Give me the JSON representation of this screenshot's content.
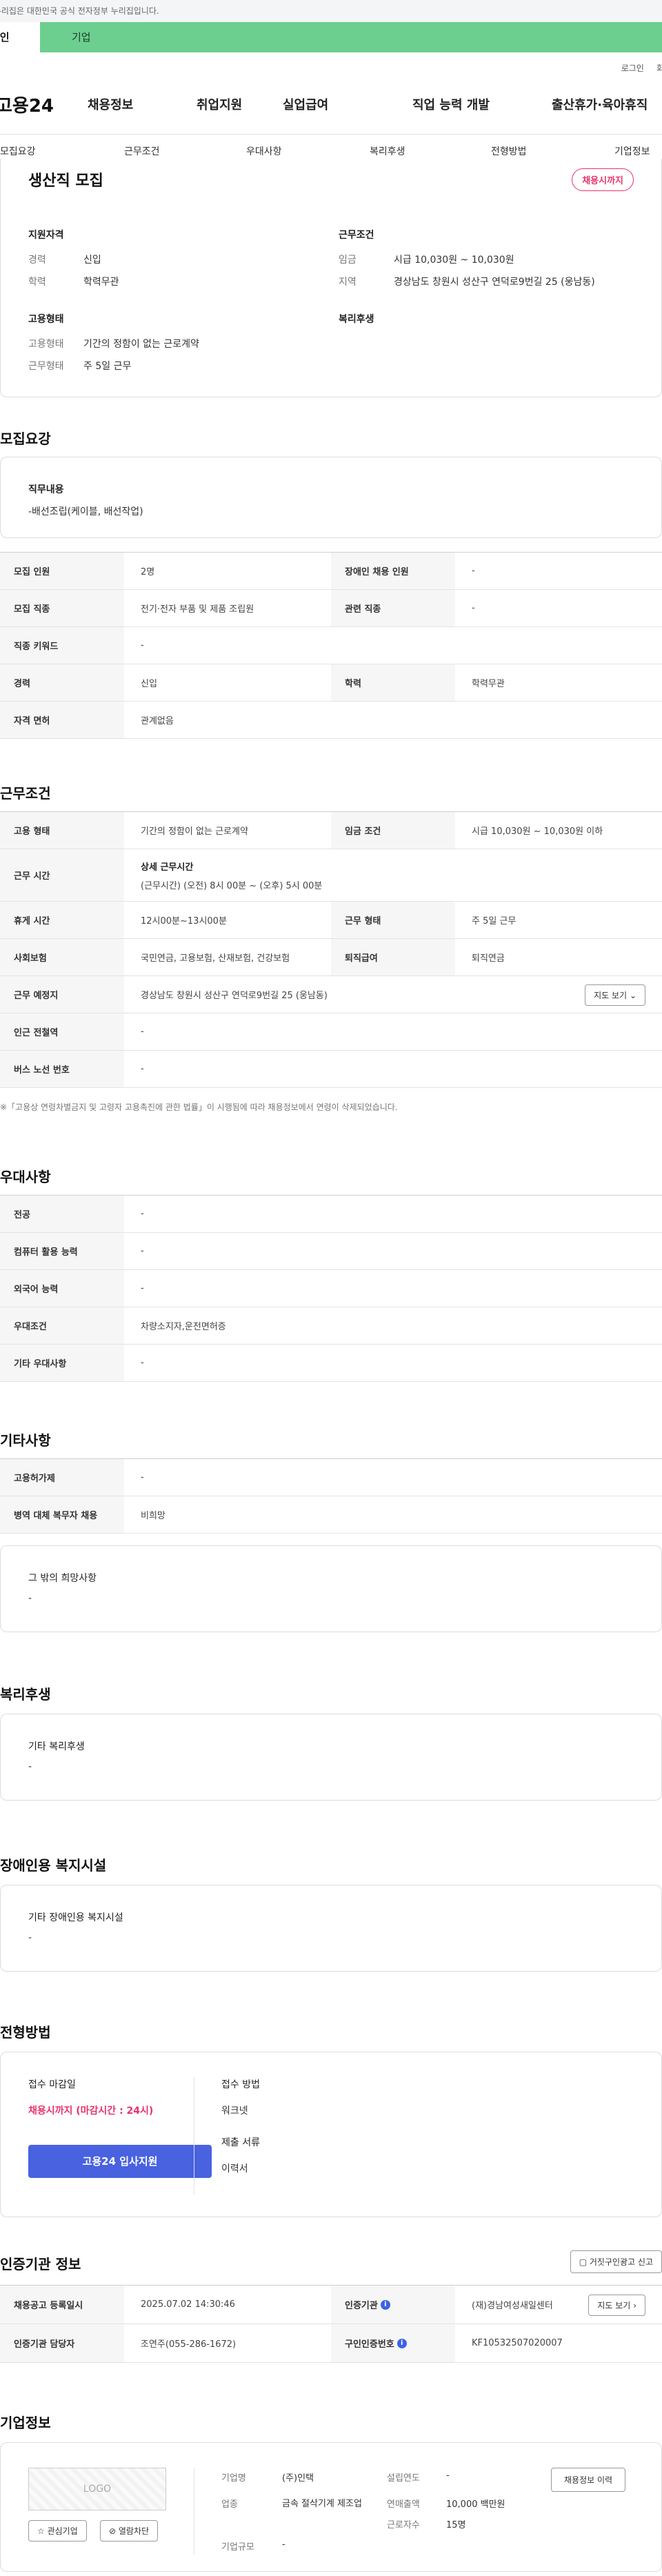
{
  "topbar": {
    "notice": "이 누리집은 대한민국 공식 전자정부 누리집입니다."
  },
  "tabs": {
    "person": "개인",
    "company": "기업"
  },
  "util": {
    "login": "로그인",
    "join": "회원가입"
  },
  "gnb": {
    "logo": "고용24",
    "items": [
      "채용정보",
      "취업지원",
      "실업급여",
      "직업 능력 개발",
      "출산휴가·육아휴직"
    ]
  },
  "subnav": [
    "모집요강",
    "근무조건",
    "우대사항",
    "복리후생",
    "전형방법",
    "기업정보"
  ],
  "summary": {
    "title": "생산직 모집",
    "badge": "채용시까지",
    "qual_title": "지원자격",
    "career_label": "경력",
    "career": "신입",
    "edu_label": "학력",
    "edu": "학력무관",
    "cond_title": "근무조건",
    "wage_label": "임금",
    "wage": "시급 10,030원 ~ 10,030원",
    "region_label": "지역",
    "region": "경상남도 창원시 성산구 연덕로9번길 25 (웅남동)",
    "emp_title": "고용형태",
    "emptype_label": "고용형태",
    "emptype": "기간의 정함이 없는 근로계약",
    "worktype_label": "근무형태",
    "worktype": "주 5일 근무",
    "welfare_title": "복리후생"
  },
  "recruit": {
    "title": "모집요강",
    "job_desc_label": "직무내용",
    "job_desc": "-배선조립(케이블, 배선작업)",
    "rows": {
      "count_h": "모집 인원",
      "count": "2명",
      "disabled_h": "장애인 채용 인원",
      "disabled": "-",
      "jobtype_h": "모집 직종",
      "jobtype": "전기·전자 부품 및 제품 조립원",
      "related_h": "관련 직종",
      "related": "-",
      "keyword_h": "직종 키워드",
      "keyword": "-",
      "career_h": "경력",
      "career": "신입",
      "edu_h": "학력",
      "edu": "학력무관",
      "license_h": "자격 면허",
      "license": "관계없음"
    }
  },
  "work": {
    "title": "근무조건",
    "emp_h": "고용 형태",
    "emp": "기간의 정함이 없는 근로계약",
    "wage_h": "임금 조건",
    "wage": "시급 10,030원 ~ 10,030원 이하",
    "time_h": "근무 시간",
    "time_t": "상세 근무시간",
    "time": "(근무시간) (오전) 8시 00분 ~ (오후) 5시 00분",
    "rest_h": "휴게 시간",
    "rest": "12시00분~13시00분",
    "form_h": "근무 형태",
    "form": "주 5일 근무",
    "ins_h": "사회보험",
    "ins": "국민연금, 고용보험, 산재보험, 건강보험",
    "sev_h": "퇴직급여",
    "sev": "퇴직연금",
    "place_h": "근무 예정지",
    "place": "경상남도 창원시 성산구 연덕로9번길 25 (웅남동)",
    "map_btn": "지도 보기",
    "subway_h": "인근 전철역",
    "subway": "-",
    "bus_h": "버스 노선 번호",
    "bus": "-",
    "note": "※「고용상 연령차별금지 및 고령자 고용촉진에 관한 법률」이 시행됨에 따라 채용정보에서 연령이 삭제되었습니다."
  },
  "pref": {
    "title": "우대사항",
    "major_h": "전공",
    "major": "-",
    "pc_h": "컴퓨터 활용 능력",
    "pc": "-",
    "lang_h": "외국어 능력",
    "lang": "-",
    "cond_h": "우대조건",
    "cond": "차량소지자,운전면허증",
    "etc_h": "기타 우대사항",
    "etc": "-"
  },
  "other": {
    "title": "기타사항",
    "permit_h": "고용허가제",
    "permit": "-",
    "military_h": "병역 대체 복무자 채용",
    "military": "비희망",
    "wish_label": "그 밖의 희망사항",
    "wish": "-"
  },
  "welfare": {
    "title": "복리후생",
    "label": "기타 복리후생",
    "value": "-"
  },
  "facility": {
    "title": "장애인용 복지시설",
    "label": "기타 장애인용 복지시설",
    "value": "-"
  },
  "selection": {
    "title": "전형방법",
    "deadline_label": "접수 마감일",
    "deadline": "채용시까지 (마감시간 : 24시)",
    "apply_btn": "고용24 입사지원",
    "method_label": "접수 방법",
    "method": "워크넷",
    "docs_label": "제출 서류",
    "docs": "이력서"
  },
  "agency": {
    "title": "인증기관 정보",
    "report_btn": "거짓구인광고 신고",
    "date_h": "채용공고 등록일시",
    "date": "2025.07.02 14:30:46",
    "org_h": "인증기관",
    "org": "(재)경남여성새일센터",
    "map_btn": "지도 보기",
    "manager_h": "인증기관 담당자",
    "manager": "조연주(055-286-1672)",
    "cert_h": "구인인증번호",
    "cert": "KF10532507020007"
  },
  "company": {
    "title": "기업정보",
    "logo": "LOGO",
    "fav_btn": "관심기업",
    "block_btn": "열람차단",
    "name_l": "기업명",
    "name": "(주)인택",
    "industry_l": "업종",
    "industry": "금속 절삭기계 제조업",
    "size_l": "기업규모",
    "size": "-",
    "year_l": "설립연도",
    "year": "-",
    "sales_l": "연매출액",
    "sales": "10,000 백만원",
    "staff_l": "근로자수",
    "staff": "15명",
    "history_btn": "채용정보 이력"
  }
}
